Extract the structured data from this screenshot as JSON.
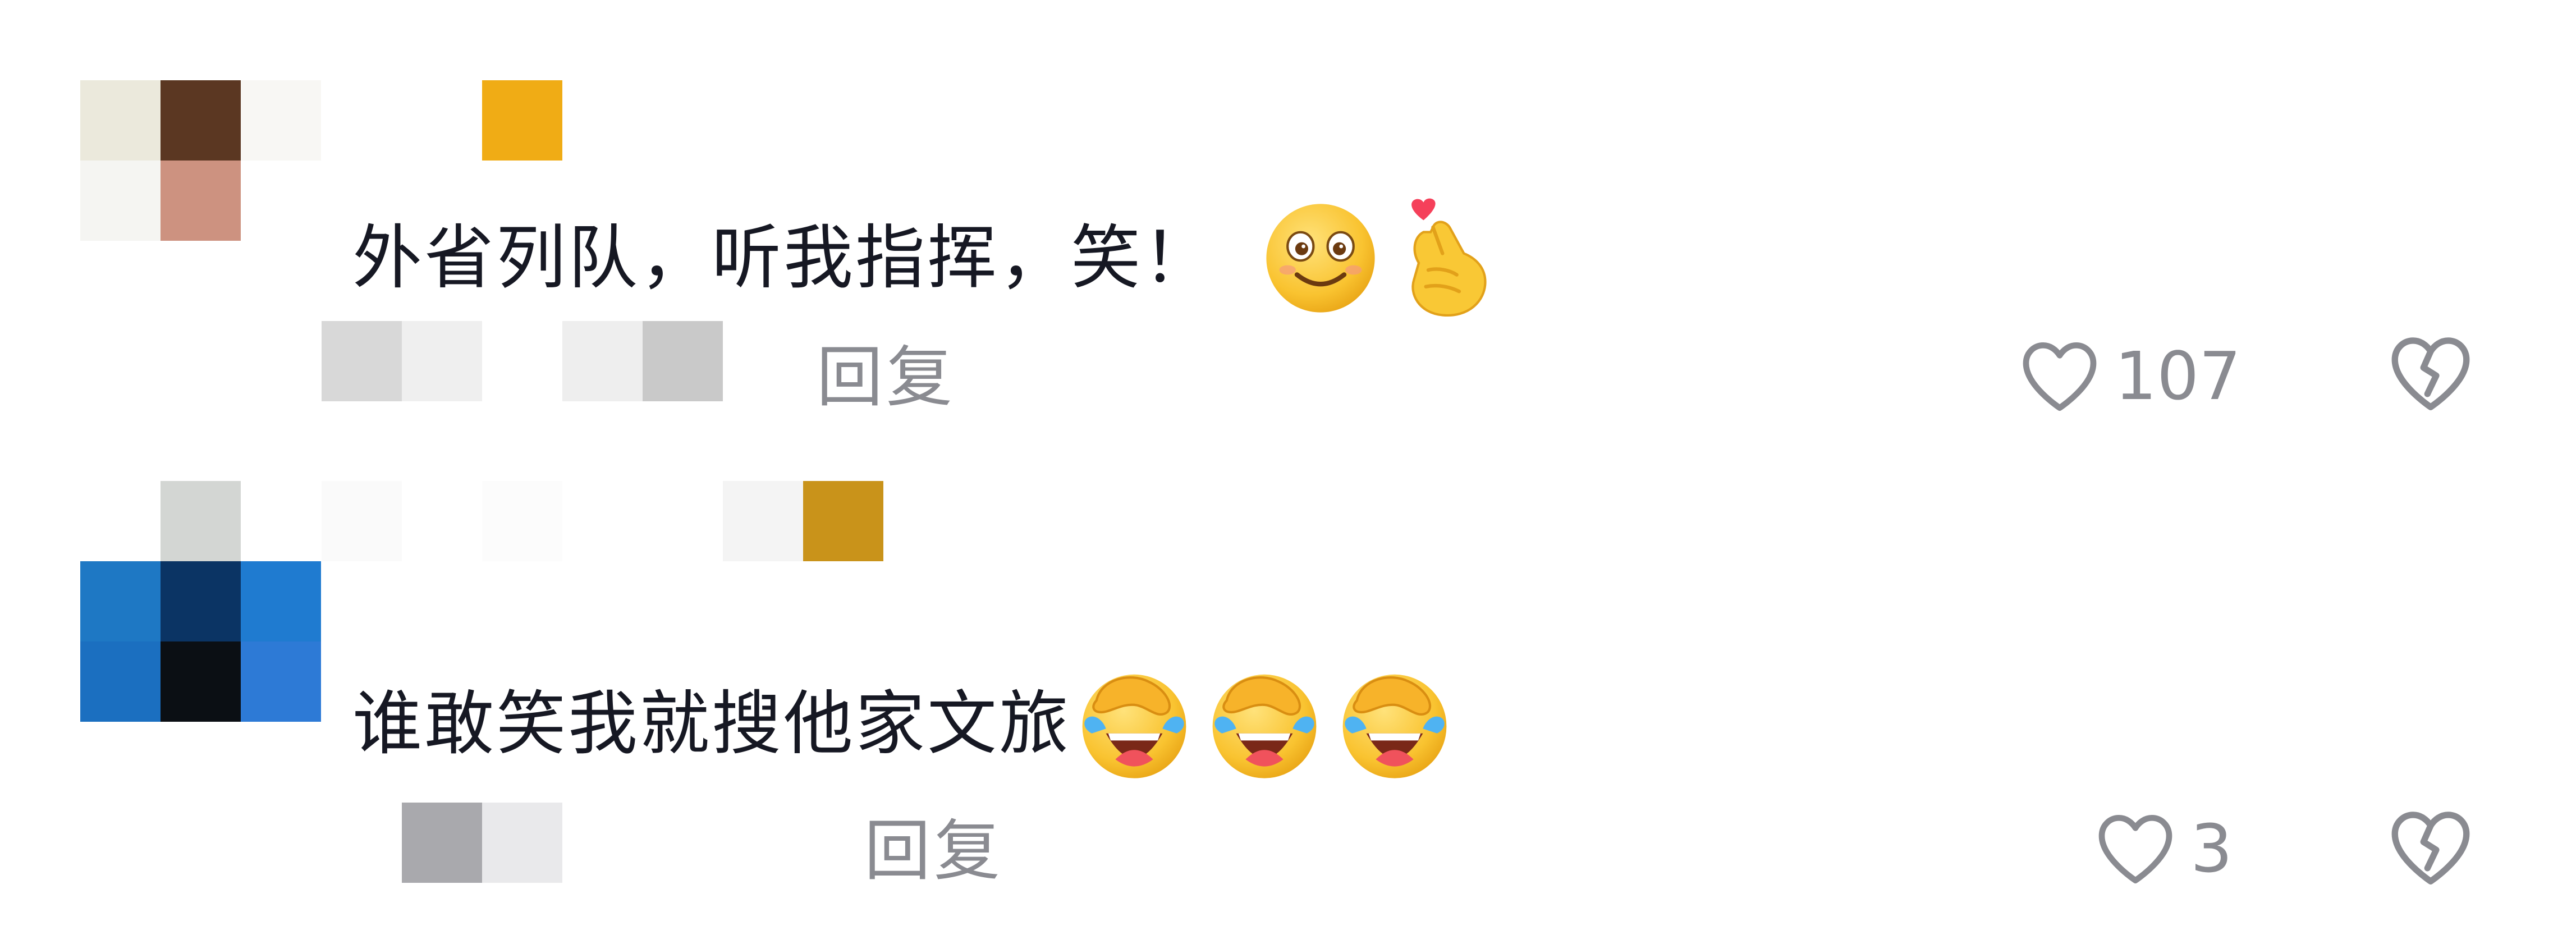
{
  "comments": [
    {
      "avatar_colors": [
        "#ebe9dc",
        "#5b3722",
        "#f8f7f4",
        "#f5f5f2",
        "#cd9280",
        "#ffffff",
        "#ffffff",
        "#ffffff",
        "#ffffff"
      ],
      "name_mosaic_colors": [
        "#ffffff",
        "#ffffff",
        "#f0ac15"
      ],
      "text": "外省列队，听我指挥，笑！",
      "emojis": [
        "smiling-face",
        "finger-heart"
      ],
      "meta_mosaic_colors": [
        "#d8d8d8",
        "#efefef",
        "#ffffff",
        "#eeeeee",
        "#c9c9c9"
      ],
      "reply_label": "回复",
      "like_count": "107",
      "like_icon": "heart-outline-icon",
      "dislike_icon": "broken-heart-icon"
    },
    {
      "avatar_colors": [
        "#ffffff",
        "#d3d6d3",
        "#ffffff",
        "#1e78c4",
        "#0b3464",
        "#1f7bd0",
        "#1b6fc0",
        "#0b0f14",
        "#2d7ad6"
      ],
      "name_mosaic_colors": [
        "#fafafa",
        "#ffffff",
        "#fcfcfc",
        "#ffffff",
        "#ffffff",
        "#f4f4f4",
        "#c9931a"
      ],
      "text": "谁敢笑我就搜他家文旅",
      "emojis": [
        "facepalm-laugh",
        "facepalm-laugh",
        "facepalm-laugh"
      ],
      "meta_mosaic_colors": [
        "#ffffff",
        "#a9a9ad",
        "#e9e9eb"
      ],
      "reply_label": "回复",
      "like_count": "3",
      "like_icon": "heart-outline-icon",
      "dislike_icon": "broken-heart-icon"
    }
  ],
  "colors": {
    "text": "#161823",
    "secondary": "#8a8b91",
    "background": "#ffffff"
  }
}
